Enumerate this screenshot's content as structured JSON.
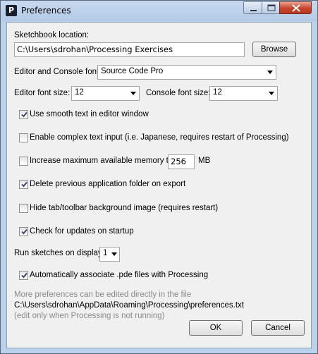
{
  "window": {
    "title": "Preferences",
    "app_icon_letter": "P"
  },
  "sketchbook": {
    "label": "Sketchbook location:",
    "path": "C:\\Users\\sdrohan\\Processing Exercises",
    "browse_label": "Browse"
  },
  "font": {
    "label": "Editor and Console font",
    "value": "Source Code Pro"
  },
  "font_size": {
    "editor_label": "Editor font size:",
    "editor_value": "12",
    "console_label": "Console font size:",
    "console_value": "12"
  },
  "options": {
    "smooth_text": {
      "label": "Use smooth text in editor window",
      "checked": true
    },
    "complex_text": {
      "label": "Enable complex text input (i.e. Japanese, requires restart of Processing)",
      "checked": false
    },
    "max_memory": {
      "label": "Increase maximum available memory to",
      "checked": false,
      "value": "256",
      "unit": "MB"
    },
    "delete_folder": {
      "label": "Delete previous application folder on export",
      "checked": true
    },
    "hide_tab": {
      "label": "Hide tab/toolbar background image (requires restart)",
      "checked": false
    },
    "check_updates": {
      "label": "Check for updates on startup",
      "checked": true
    },
    "associate_pde": {
      "label": "Automatically associate .pde files with Processing",
      "checked": true
    }
  },
  "display": {
    "label": "Run sketches on display",
    "value": "1"
  },
  "footer": {
    "note": "More preferences can be edited directly in the file",
    "file_path": "C:\\Users\\sdrohan\\AppData\\Roaming\\Processing\\preferences.txt",
    "caveat": "(edit only when Processing is not running)",
    "ok_label": "OK",
    "cancel_label": "Cancel"
  },
  "colors": {
    "frame": "#b9d1ea",
    "client_bg": "#f0f0f0",
    "close_button": "#c7422b",
    "hint_text": "#8b8b8b"
  }
}
